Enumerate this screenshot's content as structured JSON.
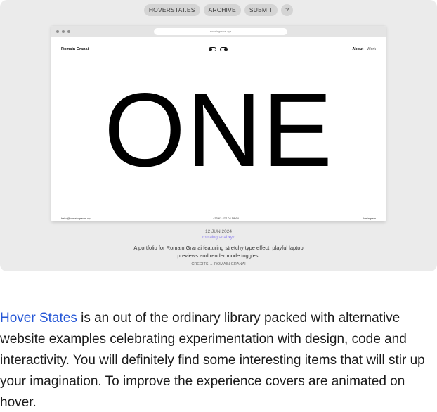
{
  "top_nav": [
    {
      "label": "HOVERSTAT.ES"
    },
    {
      "label": "ARCHIVE"
    },
    {
      "label": "SUBMIT"
    },
    {
      "label": "?"
    }
  ],
  "preview": {
    "url": "romaingranai.xyz",
    "site_name": "Romain Granai",
    "nav_about": "About",
    "nav_work": "Work",
    "hero_text": "ONE",
    "footer_email": "hello@romaingranai.xyz",
    "footer_phone": "+33 63 477 04 58 64",
    "footer_social": "Instagram"
  },
  "entry": {
    "date": "12 JUN 2024",
    "domain": "romaingranai.xyz",
    "description": "A portfolio for Romain Granai featuring stretchy type effect, playful laptop previews and render mode toggles.",
    "credits": "CREDITS → ROMAIN GRANAI"
  },
  "paragraph": {
    "link": "Hover States",
    "text": " is an out of the ordinary library packed with alternative website examples celebrating experimentation with design, code and interactivity. You will definitely find some interesting items that will stir up your imagination. To improve the experience covers are animated on hover."
  },
  "colors": {
    "card_bg": "#ebebeb",
    "pill_bg": "#d4d4d4",
    "link": "#2456d6",
    "domain_accent": "#8a7cf0"
  }
}
